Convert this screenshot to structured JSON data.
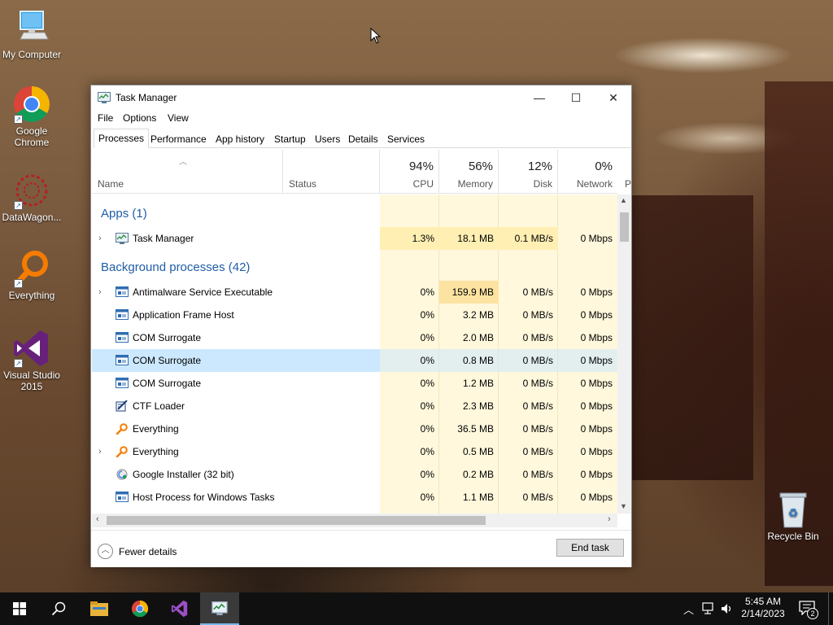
{
  "desktop": {
    "icons": [
      {
        "label": "My Computer",
        "icon": "computer-icon"
      },
      {
        "label": "Google Chrome",
        "icon": "chrome-icon"
      },
      {
        "label": "DataWagon...",
        "icon": "datawagon-icon"
      },
      {
        "label": "Everything",
        "icon": "everything-icon"
      },
      {
        "label": "Visual Studio 2015",
        "icon": "visual-studio-icon"
      },
      {
        "label": "Recycle Bin",
        "icon": "recycle-bin-icon"
      }
    ]
  },
  "window": {
    "title": "Task Manager",
    "controls": {
      "minimize": "—",
      "maximize": "☐",
      "close": "✕"
    },
    "menu": [
      "File",
      "Options",
      "View"
    ],
    "tabs": [
      "Processes",
      "Performance",
      "App history",
      "Startup",
      "Users",
      "Details",
      "Services"
    ],
    "active_tab": "Processes",
    "columns": {
      "name": "Name",
      "status": "Status",
      "cpu": {
        "label": "CPU",
        "percent": "94%"
      },
      "memory": {
        "label": "Memory",
        "percent": "56%"
      },
      "disk": {
        "label": "Disk",
        "percent": "12%"
      },
      "network": {
        "label": "Network",
        "percent": "0%"
      },
      "more": "P"
    },
    "groups": {
      "apps": "Apps (1)",
      "background": "Background processes (42)"
    },
    "apps": [
      {
        "name": "Task Manager",
        "cpu": "1.3%",
        "memory": "18.1 MB",
        "disk": "0.1 MB/s",
        "network": "0 Mbps",
        "expandable": true,
        "icon": "task-manager-icon"
      }
    ],
    "processes": [
      {
        "name": "Antimalware Service Executable",
        "cpu": "0%",
        "memory": "159.9 MB",
        "disk": "0 MB/s",
        "network": "0 Mbps",
        "expandable": true,
        "icon": "service-icon"
      },
      {
        "name": "Application Frame Host",
        "cpu": "0%",
        "memory": "3.2 MB",
        "disk": "0 MB/s",
        "network": "0 Mbps",
        "expandable": false,
        "icon": "service-icon"
      },
      {
        "name": "COM Surrogate",
        "cpu": "0%",
        "memory": "2.0 MB",
        "disk": "0 MB/s",
        "network": "0 Mbps",
        "expandable": false,
        "icon": "service-icon"
      },
      {
        "name": "COM Surrogate",
        "cpu": "0%",
        "memory": "0.8 MB",
        "disk": "0 MB/s",
        "network": "0 Mbps",
        "expandable": false,
        "icon": "service-icon",
        "selected": true
      },
      {
        "name": "COM Surrogate",
        "cpu": "0%",
        "memory": "1.2 MB",
        "disk": "0 MB/s",
        "network": "0 Mbps",
        "expandable": false,
        "icon": "service-icon"
      },
      {
        "name": "CTF Loader",
        "cpu": "0%",
        "memory": "2.3 MB",
        "disk": "0 MB/s",
        "network": "0 Mbps",
        "expandable": false,
        "icon": "ctf-loader-icon"
      },
      {
        "name": "Everything",
        "cpu": "0%",
        "memory": "36.5 MB",
        "disk": "0 MB/s",
        "network": "0 Mbps",
        "expandable": false,
        "icon": "everything-icon"
      },
      {
        "name": "Everything",
        "cpu": "0%",
        "memory": "0.5 MB",
        "disk": "0 MB/s",
        "network": "0 Mbps",
        "expandable": true,
        "icon": "everything-icon"
      },
      {
        "name": "Google Installer (32 bit)",
        "cpu": "0%",
        "memory": "0.2 MB",
        "disk": "0 MB/s",
        "network": "0 Mbps",
        "expandable": false,
        "icon": "google-installer-icon"
      },
      {
        "name": "Host Process for Windows Tasks",
        "cpu": "0%",
        "memory": "1.1 MB",
        "disk": "0 MB/s",
        "network": "0 Mbps",
        "expandable": false,
        "icon": "service-icon"
      }
    ],
    "footer": {
      "fewer_details": "Fewer details",
      "end_task": "End task"
    }
  },
  "taskbar": {
    "apps": [
      "start-icon",
      "search-icon",
      "file-explorer-icon",
      "chrome-icon",
      "visual-studio-icon",
      "task-manager-icon"
    ],
    "clock_time": "5:45 AM",
    "clock_date": "2/14/2023",
    "notification_count": "2"
  },
  "colors": {
    "group_title": "#1f5ea8",
    "selected_row": "#cce8ff",
    "heat_light": "#fff8dc",
    "heat_medium": "#ffefb3",
    "heat_strong": "#fde3a2",
    "accent": "#76b9ed"
  }
}
